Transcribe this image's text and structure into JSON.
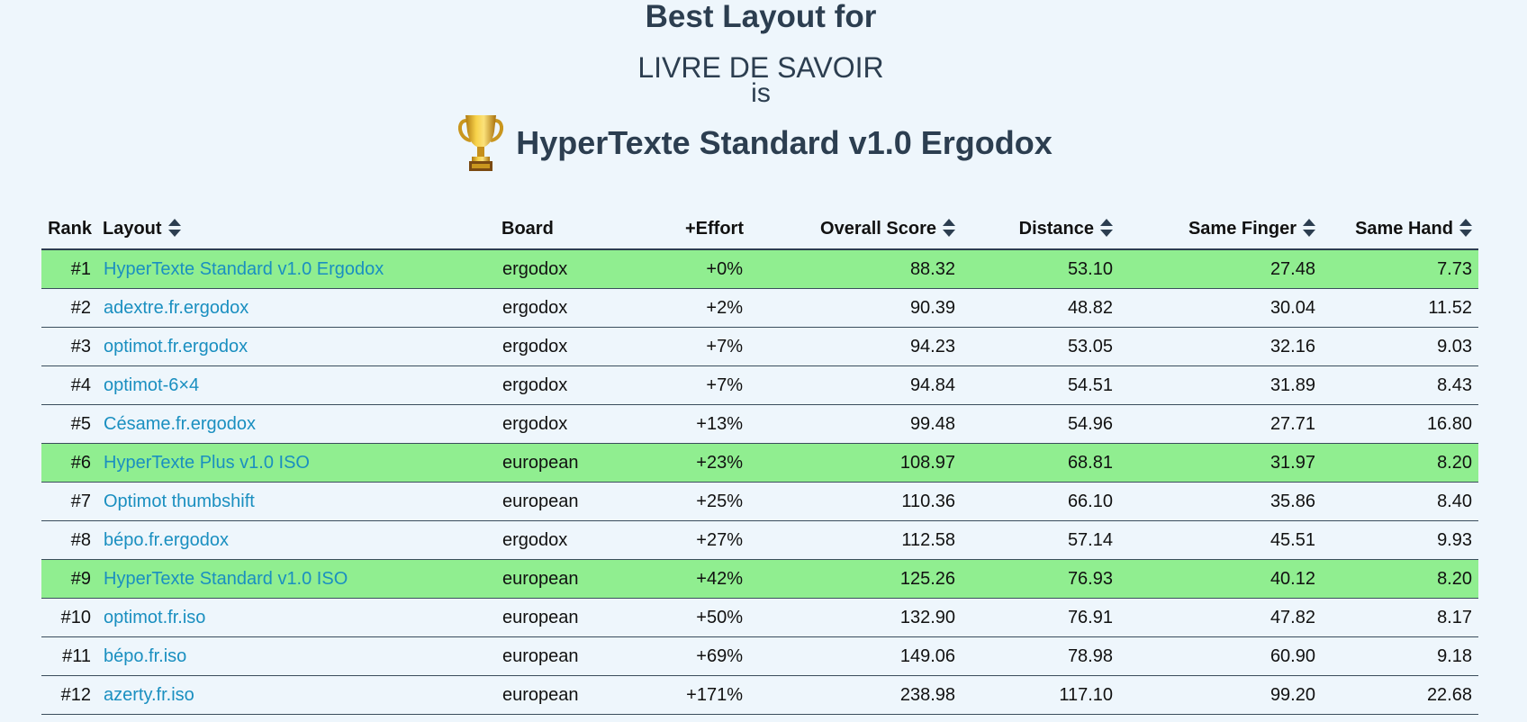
{
  "header": {
    "title": "Best Layout for",
    "corpus": "LIVRE DE SAVOIR",
    "connector": "is",
    "winner": "HyperTexte Standard v1.0 Ergodox",
    "winner_icon": "trophy-icon"
  },
  "colors": {
    "background": "#eef6fc",
    "highlight_row": "#90ee90",
    "link": "#1a8fc0",
    "heading": "#2c3e50"
  },
  "table": {
    "columns": [
      {
        "label": "Rank",
        "sortable": false
      },
      {
        "label": "Layout",
        "sortable": true
      },
      {
        "label": "Board",
        "sortable": false
      },
      {
        "label": "+Effort",
        "sortable": false
      },
      {
        "label": "Overall Score",
        "sortable": true
      },
      {
        "label": "Distance",
        "sortable": true
      },
      {
        "label": "Same Finger",
        "sortable": true
      },
      {
        "label": "Same Hand",
        "sortable": true
      }
    ],
    "rows": [
      {
        "rank": "#1",
        "layout": "HyperTexte Standard v1.0 Ergodox",
        "board": "ergodox",
        "effort": "+0%",
        "overall": "88.32",
        "distance": "53.10",
        "same_finger": "27.48",
        "same_hand": "7.73",
        "highlight": true
      },
      {
        "rank": "#2",
        "layout": "adextre.fr.ergodox",
        "board": "ergodox",
        "effort": "+2%",
        "overall": "90.39",
        "distance": "48.82",
        "same_finger": "30.04",
        "same_hand": "11.52",
        "highlight": false
      },
      {
        "rank": "#3",
        "layout": "optimot.fr.ergodox",
        "board": "ergodox",
        "effort": "+7%",
        "overall": "94.23",
        "distance": "53.05",
        "same_finger": "32.16",
        "same_hand": "9.03",
        "highlight": false
      },
      {
        "rank": "#4",
        "layout": "optimot-6×4",
        "board": "ergodox",
        "effort": "+7%",
        "overall": "94.84",
        "distance": "54.51",
        "same_finger": "31.89",
        "same_hand": "8.43",
        "highlight": false
      },
      {
        "rank": "#5",
        "layout": "Césame.fr.ergodox",
        "board": "ergodox",
        "effort": "+13%",
        "overall": "99.48",
        "distance": "54.96",
        "same_finger": "27.71",
        "same_hand": "16.80",
        "highlight": false
      },
      {
        "rank": "#6",
        "layout": "HyperTexte Plus v1.0 ISO",
        "board": "european",
        "effort": "+23%",
        "overall": "108.97",
        "distance": "68.81",
        "same_finger": "31.97",
        "same_hand": "8.20",
        "highlight": true
      },
      {
        "rank": "#7",
        "layout": "Optimot thumbshift",
        "board": "european",
        "effort": "+25%",
        "overall": "110.36",
        "distance": "66.10",
        "same_finger": "35.86",
        "same_hand": "8.40",
        "highlight": false
      },
      {
        "rank": "#8",
        "layout": "bépo.fr.ergodox",
        "board": "ergodox",
        "effort": "+27%",
        "overall": "112.58",
        "distance": "57.14",
        "same_finger": "45.51",
        "same_hand": "9.93",
        "highlight": false
      },
      {
        "rank": "#9",
        "layout": "HyperTexte Standard v1.0 ISO",
        "board": "european",
        "effort": "+42%",
        "overall": "125.26",
        "distance": "76.93",
        "same_finger": "40.12",
        "same_hand": "8.20",
        "highlight": true
      },
      {
        "rank": "#10",
        "layout": "optimot.fr.iso",
        "board": "european",
        "effort": "+50%",
        "overall": "132.90",
        "distance": "76.91",
        "same_finger": "47.82",
        "same_hand": "8.17",
        "highlight": false
      },
      {
        "rank": "#11",
        "layout": "bépo.fr.iso",
        "board": "european",
        "effort": "+69%",
        "overall": "149.06",
        "distance": "78.98",
        "same_finger": "60.90",
        "same_hand": "9.18",
        "highlight": false
      },
      {
        "rank": "#12",
        "layout": "azerty.fr.iso",
        "board": "european",
        "effort": "+171%",
        "overall": "238.98",
        "distance": "117.10",
        "same_finger": "99.20",
        "same_hand": "22.68",
        "highlight": false
      }
    ]
  }
}
